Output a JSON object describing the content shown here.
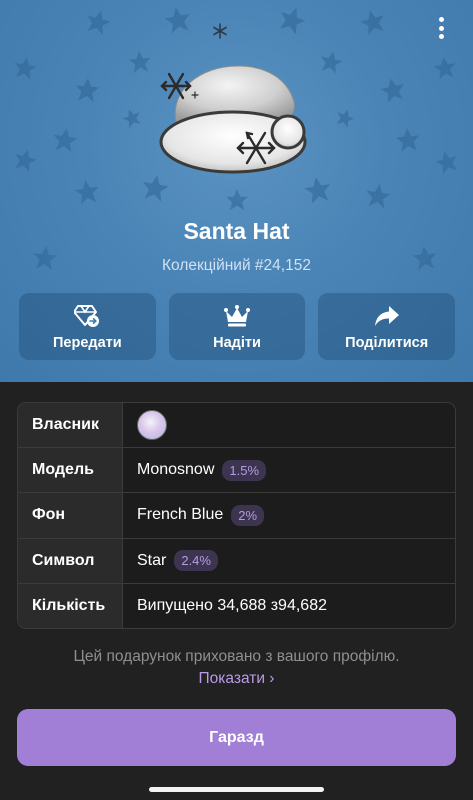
{
  "gift": {
    "title": "Santa Hat",
    "subtitle": "Колекційний #24,152"
  },
  "actions": [
    {
      "label": "Передати",
      "icon": "gift-transfer-icon"
    },
    {
      "label": "Надіти",
      "icon": "crown-icon"
    },
    {
      "label": "Поділитися",
      "icon": "share-arrow-icon"
    }
  ],
  "details": {
    "owner_label": "Власник",
    "model_label": "Модель",
    "model_value": "Monosnow",
    "model_rarity": "1.5%",
    "backdrop_label": "Фон",
    "backdrop_value": "French Blue",
    "backdrop_rarity": "2%",
    "symbol_label": "Символ",
    "symbol_value": "Star",
    "symbol_rarity": "2.4%",
    "quantity_label": "Кількість",
    "quantity_value": "Випущено 34,688 з94,682"
  },
  "footer": {
    "note": "Цей подарунок приховано з вашого профілю.",
    "show_link": "Показати ›",
    "ok_button": "Гаразд"
  },
  "colors": {
    "backdrop": "#4a84b6",
    "accent": "#a27fd6",
    "badge_text": "#b59be3",
    "background": "#212121"
  }
}
